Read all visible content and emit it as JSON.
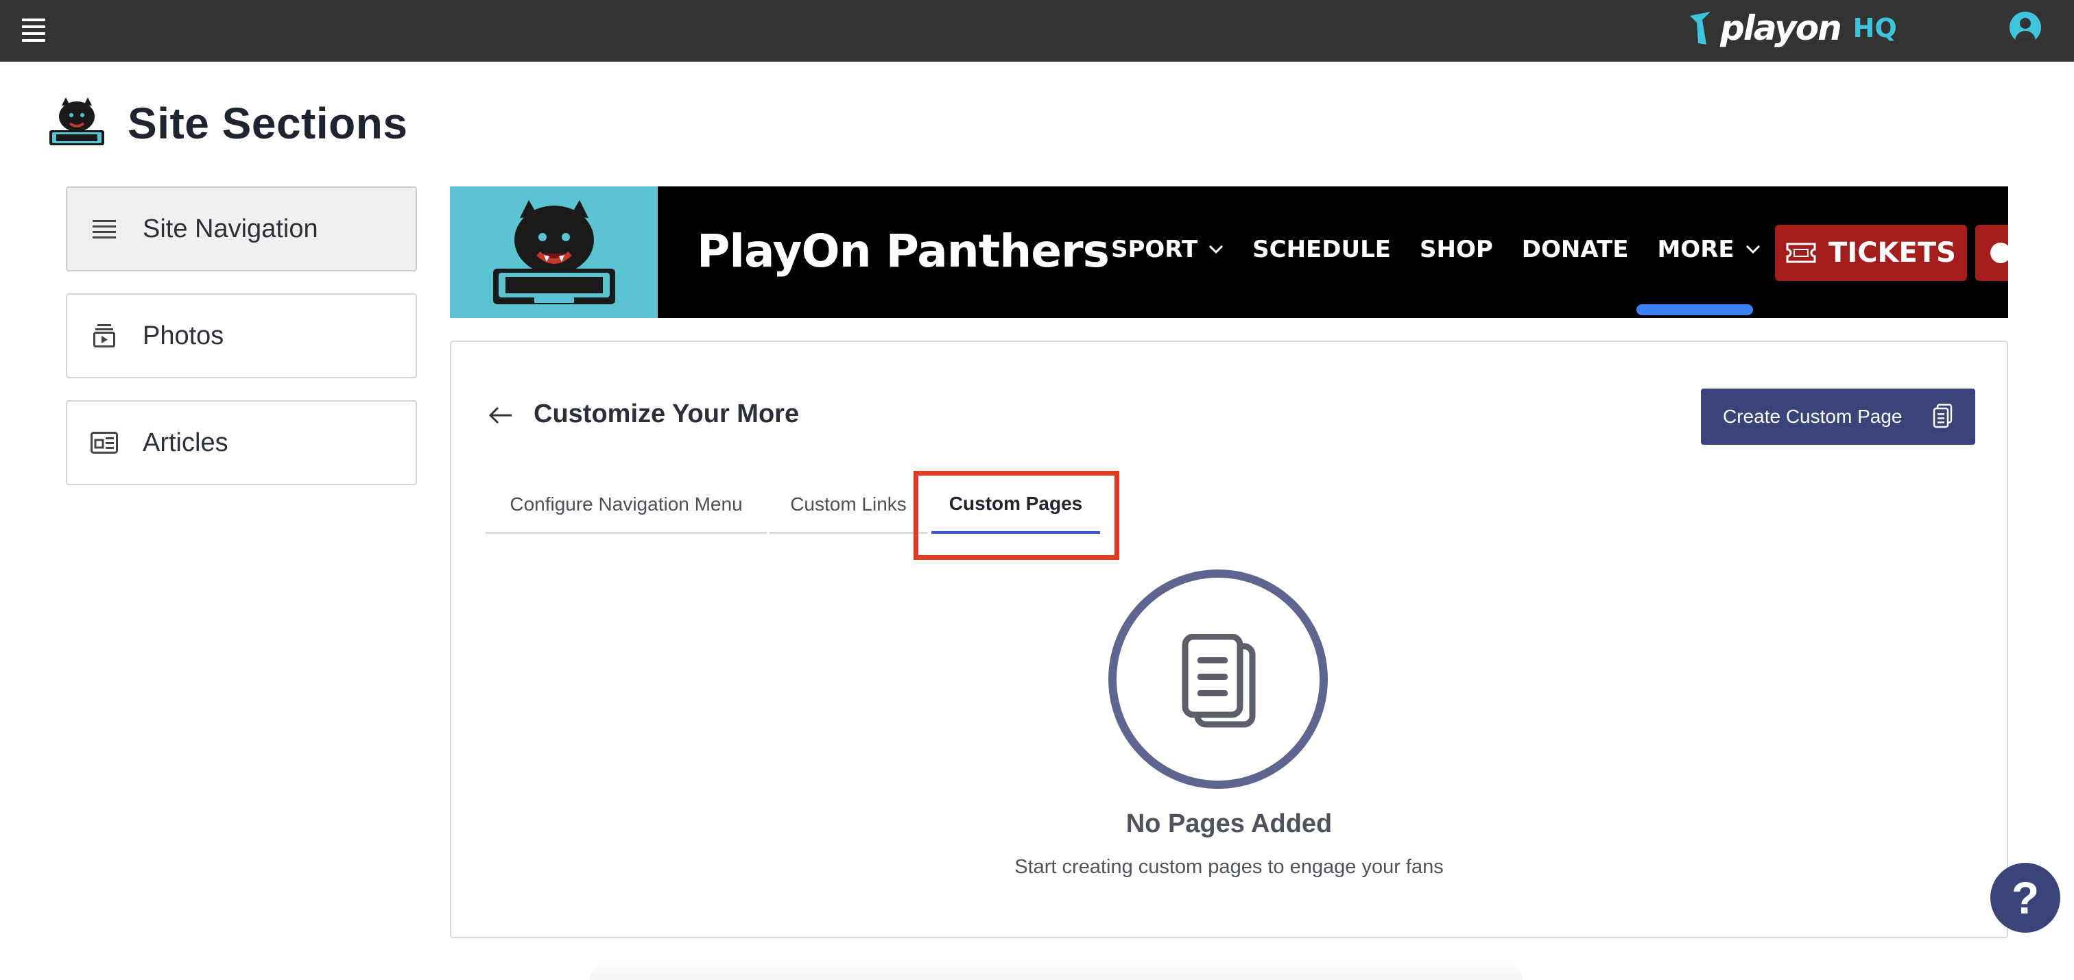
{
  "topbar": {
    "menu_icon": "hamburger-icon",
    "brand_word": "playon",
    "brand_suffix": "HQ",
    "account_icon": "user-avatar-icon",
    "brand_color": "#3ec5dd"
  },
  "page": {
    "title": "Site Sections"
  },
  "sidebar": {
    "items": [
      {
        "label": "Site Navigation",
        "icon": "list-icon",
        "active": true
      },
      {
        "label": "Photos",
        "icon": "photo-stack-icon",
        "active": false
      },
      {
        "label": "Articles",
        "icon": "newspaper-icon",
        "active": false
      }
    ]
  },
  "banner": {
    "team_name": "PlayOn Panthers",
    "nav": [
      {
        "label": "SPORT",
        "has_dropdown": true
      },
      {
        "label": "SCHEDULE",
        "has_dropdown": false
      },
      {
        "label": "SHOP",
        "has_dropdown": false
      },
      {
        "label": "DONATE",
        "has_dropdown": false
      },
      {
        "label": "MORE",
        "has_dropdown": true,
        "selected": true
      }
    ],
    "tickets_label": "TICKETS",
    "logo_bg": "#5bc3d1",
    "accent": "#a31d1d"
  },
  "card": {
    "title": "Customize Your More",
    "create_button": "Create Custom Page",
    "tabs": [
      {
        "label": "Configure Navigation Menu",
        "active": false
      },
      {
        "label": "Custom Links",
        "active": false
      },
      {
        "label": "Custom Pages",
        "active": true
      }
    ],
    "empty_state": {
      "title": "No Pages Added",
      "subtitle": "Start creating custom pages to engage your fans",
      "icon": "documents-icon"
    }
  },
  "help": {
    "label": "?"
  },
  "colors": {
    "primary": "#3a4478",
    "highlight": "#e33a24",
    "tab_underline": "#3b5bdb"
  }
}
